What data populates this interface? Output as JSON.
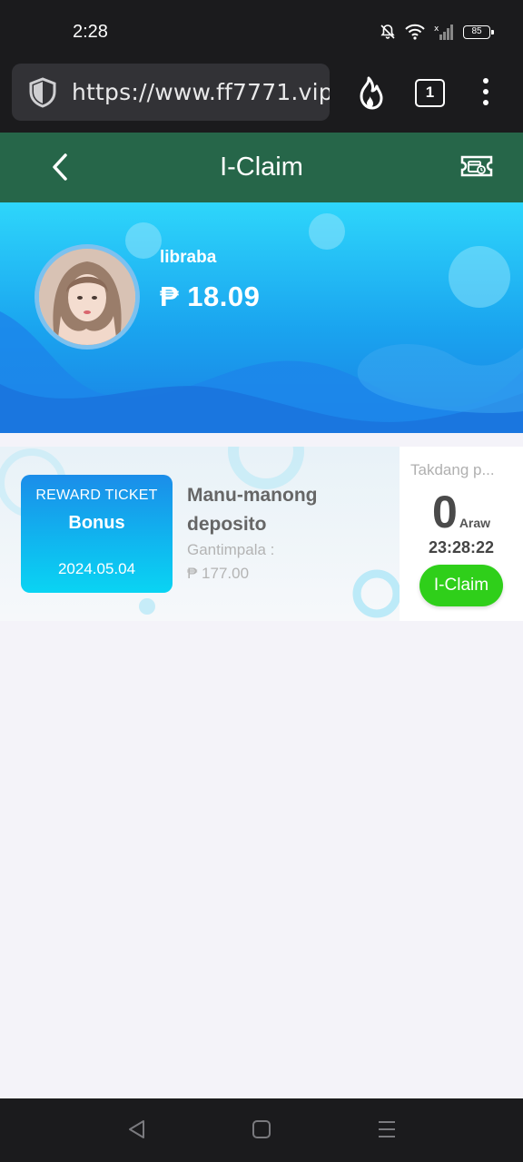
{
  "status_bar": {
    "time": "2:28",
    "battery": "85"
  },
  "browser": {
    "url": "https://www.ff7771.vip/",
    "tab_count": "1"
  },
  "header": {
    "title": "I-Claim"
  },
  "profile": {
    "username": "libraba",
    "balance": "₱ 18.09"
  },
  "reward": {
    "ticket_label": "REWARD TICKET",
    "ticket_type": "Bonus",
    "ticket_date": "2024.05.04",
    "title": "Manu-manong deposito",
    "reward_label": "Gantimpala :",
    "reward_amount": "₱ 177.00",
    "deadline_label": "Takdang p...",
    "days_value": "0",
    "days_unit": "Araw",
    "countdown": "23:28:22",
    "claim_label": "I-Claim"
  },
  "colors": {
    "header_bg": "#266649",
    "claim_button": "#2fcf1a",
    "hero_top": "#2ed6fb",
    "hero_bottom": "#1b7fe4"
  }
}
